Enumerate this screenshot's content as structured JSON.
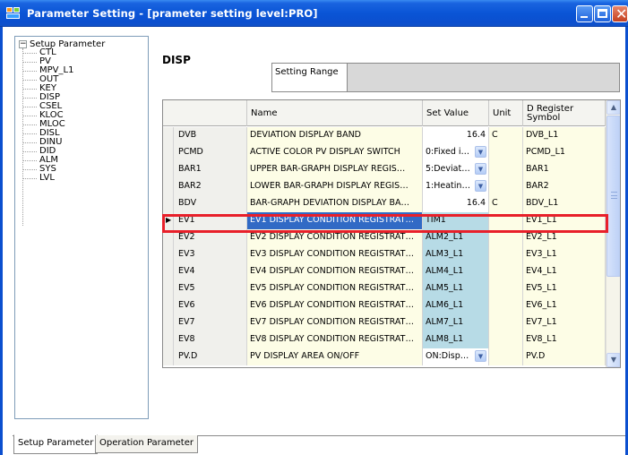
{
  "window": {
    "title": "Parameter Setting - [prameter setting level:PRO]"
  },
  "tree": {
    "root_label": "Setup Parameter",
    "toggle": "−",
    "items": [
      "CTL",
      "PV",
      "MPV_L1",
      "OUT",
      "KEY",
      "DISP",
      "CSEL",
      "KLOC",
      "MLOC",
      "DISL",
      "DINU",
      "DID",
      "ALM",
      "SYS",
      "LVL"
    ]
  },
  "main": {
    "section_title": "DISP",
    "setting_range_label": "Setting Range",
    "setting_range_value": ""
  },
  "grid": {
    "columns": {
      "name": "Name",
      "set_value": "Set Value",
      "unit": "Unit",
      "register": "D Register Symbol"
    },
    "rows": [
      {
        "symbol": "DVB",
        "name": "DEVIATION DISPLAY BAND",
        "value": "16.4",
        "unit": "C",
        "register": "DVB_L1",
        "kind": "num"
      },
      {
        "symbol": "PCMD",
        "name": "ACTIVE COLOR PV DISPLAY SWITCH",
        "value": "0:Fixed i…",
        "unit": "",
        "register": "PCMD_L1",
        "kind": "combo"
      },
      {
        "symbol": "BAR1",
        "name": "UPPER BAR-GRAPH DISPLAY REGIS…",
        "value": "5:Deviat…",
        "unit": "",
        "register": "BAR1",
        "kind": "combo"
      },
      {
        "symbol": "BAR2",
        "name": "LOWER BAR-GRAPH DISPLAY REGIS…",
        "value": "1:Heatin…",
        "unit": "",
        "register": "BAR2",
        "kind": "combo"
      },
      {
        "symbol": "BDV",
        "name": "BAR-GRAPH DEVIATION DISPLAY BA…",
        "value": "16.4",
        "unit": "C",
        "register": "BDV_L1",
        "kind": "num"
      },
      {
        "symbol": "EV1",
        "name": "EV1 DISPLAY CONDITION REGISTRAT…",
        "value": "TIM1",
        "unit": "",
        "register": "EV1_L1",
        "kind": "blue",
        "selected": true
      },
      {
        "symbol": "EV2",
        "name": "EV2 DISPLAY CONDITION REGISTRAT…",
        "value": "ALM2_L1",
        "unit": "",
        "register": "EV2_L1",
        "kind": "blue"
      },
      {
        "symbol": "EV3",
        "name": "EV3 DISPLAY CONDITION REGISTRAT…",
        "value": "ALM3_L1",
        "unit": "",
        "register": "EV3_L1",
        "kind": "blue"
      },
      {
        "symbol": "EV4",
        "name": "EV4 DISPLAY CONDITION REGISTRAT…",
        "value": "ALM4_L1",
        "unit": "",
        "register": "EV4_L1",
        "kind": "blue"
      },
      {
        "symbol": "EV5",
        "name": "EV5 DISPLAY CONDITION REGISTRAT…",
        "value": "ALM5_L1",
        "unit": "",
        "register": "EV5_L1",
        "kind": "blue"
      },
      {
        "symbol": "EV6",
        "name": "EV6 DISPLAY CONDITION REGISTRAT…",
        "value": "ALM6_L1",
        "unit": "",
        "register": "EV6_L1",
        "kind": "blue"
      },
      {
        "symbol": "EV7",
        "name": "EV7 DISPLAY CONDITION REGISTRAT…",
        "value": "ALM7_L1",
        "unit": "",
        "register": "EV7_L1",
        "kind": "blue"
      },
      {
        "symbol": "EV8",
        "name": "EV8 DISPLAY CONDITION REGISTRAT…",
        "value": "ALM8_L1",
        "unit": "",
        "register": "EV8_L1",
        "kind": "blue"
      },
      {
        "symbol": "PV.D",
        "name": "PV DISPLAY AREA ON/OFF",
        "value": "ON:Disp…",
        "unit": "",
        "register": "PV.D",
        "kind": "combo"
      }
    ]
  },
  "tabs": [
    {
      "label": "Setup Parameter",
      "active": true
    },
    {
      "label": "Operation Parameter",
      "active": false
    }
  ],
  "icons": {
    "combo_arrow": "▼",
    "row_pointer": "▶",
    "scroll_up": "▲",
    "scroll_down": "▼",
    "close": "✕"
  },
  "colors": {
    "titlebar": "#0b4fcf",
    "selection": "#316ac5",
    "value_blue": "#b7dbe6",
    "cell_yellow": "#fdfde6",
    "highlight_box": "#e8202a"
  }
}
